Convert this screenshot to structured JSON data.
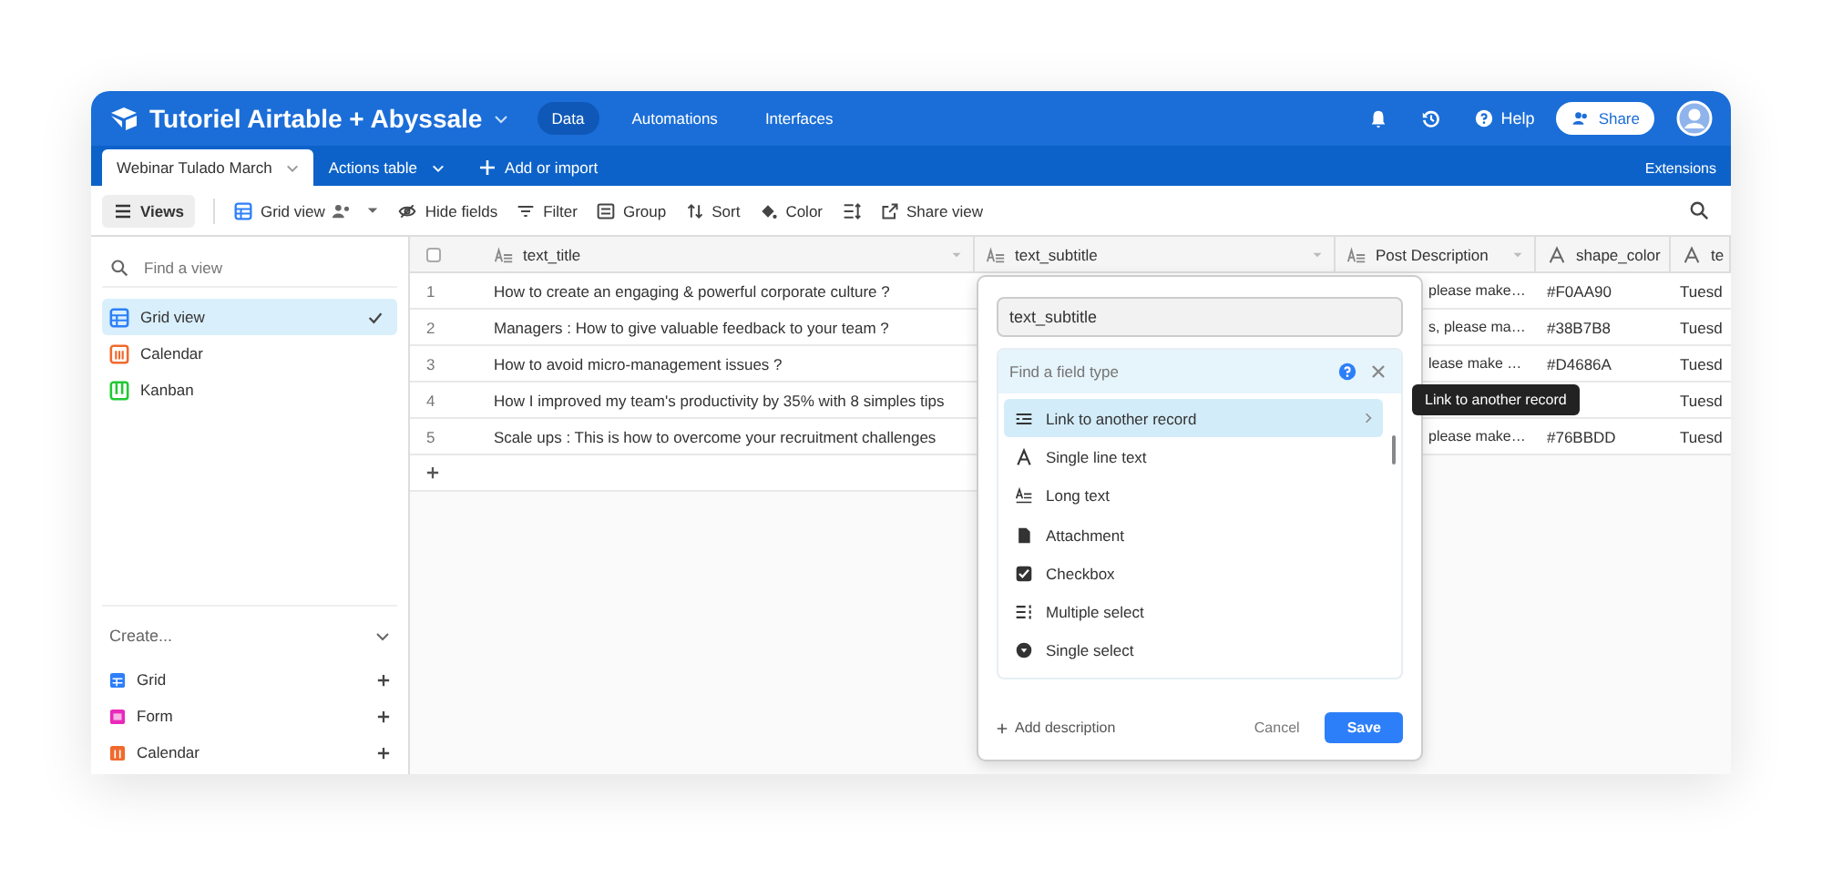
{
  "base": {
    "name": "Tutoriel Airtable + Abyssale",
    "nav": [
      {
        "label": "Data",
        "selected": true
      },
      {
        "label": "Automations",
        "selected": false
      },
      {
        "label": "Interfaces",
        "selected": false
      }
    ],
    "help": "Help",
    "share": "Share"
  },
  "tables": {
    "tabs": [
      {
        "label": "Webinar Tulado March",
        "selected": true
      },
      {
        "label": "Actions table",
        "selected": false
      }
    ],
    "add": "Add or import",
    "extensions": "Extensions"
  },
  "toolbar": {
    "views": "Views",
    "view_name": "Grid view",
    "actions": [
      {
        "label": "Hide fields",
        "kind": "hide"
      },
      {
        "label": "Filter",
        "kind": "filter"
      },
      {
        "label": "Group",
        "kind": "group"
      },
      {
        "label": "Sort",
        "kind": "sort"
      },
      {
        "label": "Color",
        "kind": "color"
      },
      {
        "kind": "row_height"
      },
      {
        "label": "Share view",
        "kind": "share"
      }
    ]
  },
  "sidebar": {
    "search_placeholder": "Find a view",
    "views": [
      {
        "label": "Grid view",
        "kind": "grid",
        "selected": true
      },
      {
        "label": "Calendar",
        "kind": "calendar",
        "selected": false
      },
      {
        "label": "Kanban",
        "kind": "kanban",
        "selected": false
      }
    ],
    "create": {
      "label": "Create...",
      "items": [
        {
          "label": "Grid",
          "kind": "grid"
        },
        {
          "label": "Form",
          "kind": "form"
        },
        {
          "label": "Calendar",
          "kind": "calendar"
        }
      ]
    }
  },
  "table": {
    "select_all": {
      "checked": false
    },
    "columns": [
      {
        "label": "text_title",
        "kind": "long"
      },
      {
        "label": "text_subtitle",
        "kind": "long"
      },
      {
        "label": "Post Description",
        "kind": "long"
      },
      {
        "label": "shape_color",
        "kind": "single"
      },
      {
        "label": "te",
        "kind": "single"
      }
    ],
    "rows": [
      {
        "number": "1",
        "cells": [
          "How to create an engaging & powerful corporate culture ?",
          "",
          "please make…",
          "#F0AA90",
          "Tuesd"
        ]
      },
      {
        "number": "2",
        "cells": [
          "Managers : How to give valuable feedback to your team ?",
          "",
          "s, please ma…",
          "#38B7B8",
          "Tuesd"
        ]
      },
      {
        "number": "3",
        "cells": [
          "How to avoid micro-management issues ?",
          "",
          "lease make …",
          "#D4686A",
          "Tuesd"
        ]
      },
      {
        "number": "4",
        "cells": [
          "How I improved my team's productivity by 35% with 8 simples tips",
          "",
          "",
          "",
          "Tuesd"
        ]
      },
      {
        "number": "5",
        "cells": [
          "Scale ups : This is how to overcome your recruitment challenges",
          "",
          "please make…",
          "#76BBDD",
          "Tuesd"
        ]
      }
    ]
  },
  "field_popup": {
    "name": "text_subtitle",
    "search_placeholder": "Find a field type",
    "types": [
      {
        "label": "Link to another record",
        "kind": "link",
        "selected": true
      },
      {
        "label": "Single line text",
        "kind": "single_line",
        "selected": false
      },
      {
        "label": "Long text",
        "kind": "long_text",
        "selected": false
      },
      {
        "label": "Attachment",
        "kind": "attachment",
        "selected": false
      },
      {
        "label": "Checkbox",
        "kind": "checkbox",
        "selected": false
      },
      {
        "label": "Multiple select",
        "kind": "multi_select",
        "selected": false
      },
      {
        "label": "Single select",
        "kind": "single_select",
        "selected": false
      }
    ],
    "add_description": "Add description",
    "cancel": "Cancel",
    "save": "Save"
  },
  "tooltip": "Link to another record"
}
